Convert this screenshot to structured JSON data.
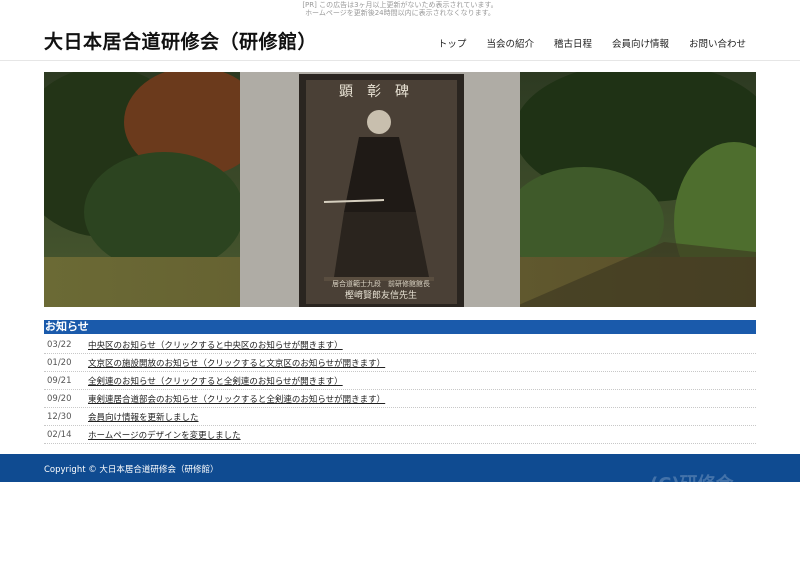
{
  "ad_notice": {
    "line1": "[PR] この広告は3ヶ月以上更新がないため表示されています。",
    "line2": "ホームページを更新後24時間以内に表示されなくなります。"
  },
  "site": {
    "title": "大日本居合道研修会（研修館）"
  },
  "nav": {
    "items": [
      {
        "label": "トップ"
      },
      {
        "label": "当会の紹介"
      },
      {
        "label": "稽古日程"
      },
      {
        "label": "会員向け情報"
      },
      {
        "label": "お問い合わせ"
      }
    ]
  },
  "hero": {
    "monument_title": "顕彰碑",
    "inscription_line1": "居合道範士九段　前研修館館長",
    "inscription_line2": "樫﨑賢郎友信先生"
  },
  "news": {
    "heading": "お知らせ",
    "items": [
      {
        "date": "03/22",
        "text": "中央区のお知らせ（クリックすると中央区のお知らせが開きます）"
      },
      {
        "date": "01/20",
        "text": "文京区の施設開放のお知らせ（クリックすると文京区のお知らせが開きます）"
      },
      {
        "date": "09/21",
        "text": "全剣連のお知らせ（クリックすると全剣連のお知らせが開きます）"
      },
      {
        "date": "09/20",
        "text": "東剣連居合道部会のお知らせ（クリックすると全剣連のお知らせが開きます）"
      },
      {
        "date": "12/30",
        "text": "会員向け情報を更新しました"
      },
      {
        "date": "02/14",
        "text": "ホームページのデザインを変更しました"
      }
    ]
  },
  "footer": {
    "copyright": "Copyright © 大日本居合道研修会（研修館）",
    "watermark": "(C)研修会"
  },
  "colors": {
    "accent": "#1a5aab",
    "footer": "#0f4b91"
  }
}
